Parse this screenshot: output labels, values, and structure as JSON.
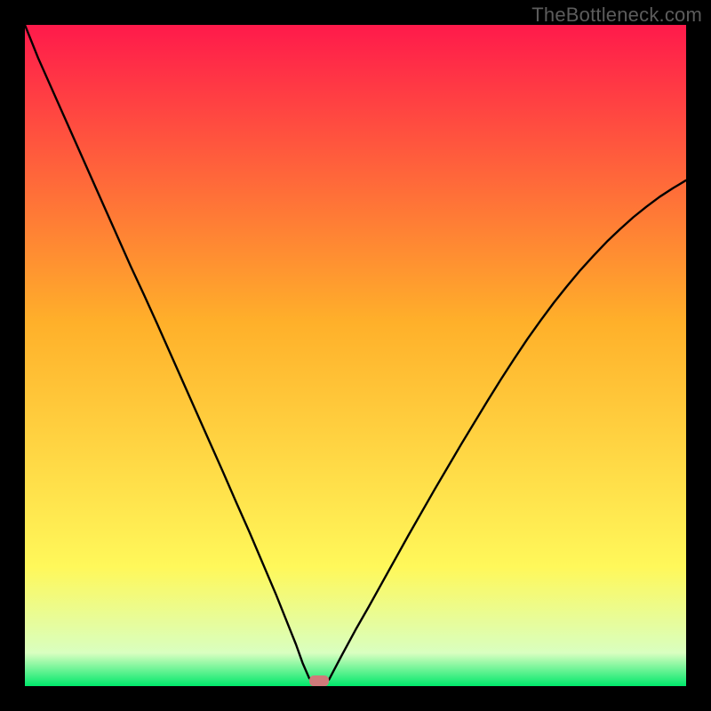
{
  "watermark_text": "TheBottleneck.com",
  "chart_data": {
    "type": "line",
    "title": "",
    "xlabel": "",
    "ylabel": "",
    "xlim": [
      0,
      100
    ],
    "ylim": [
      0,
      100
    ],
    "grid": false,
    "legend": false,
    "background_gradient": {
      "top": "#ff1a4b",
      "mid": "#ffb02a",
      "lower": "#fff85a",
      "band_pale_green": "#d9ffc0",
      "bottom": "#00e86b"
    },
    "marker": {
      "x": 44.5,
      "y": 0.8,
      "color": "#d07a7a",
      "shape": "rounded-pill"
    },
    "series": [
      {
        "name": "curve",
        "color": "#000000",
        "x": [
          0,
          2,
          4,
          6,
          8,
          10,
          12,
          14,
          16,
          18,
          20,
          22,
          24,
          26,
          28,
          30,
          32,
          34,
          36,
          38,
          40,
          41,
          42,
          43,
          44,
          45,
          46,
          48,
          50,
          52,
          54,
          56,
          58,
          60,
          62,
          64,
          66,
          68,
          70,
          72,
          74,
          76,
          78,
          80,
          82,
          84,
          86,
          88,
          90,
          92,
          94,
          96,
          98,
          100
        ],
        "y": [
          100,
          95,
          90.5,
          86,
          81.5,
          77,
          72.5,
          68,
          63.5,
          59.2,
          54.8,
          50.3,
          45.8,
          41.3,
          36.8,
          32.3,
          27.7,
          23.2,
          18.5,
          13.8,
          8.8,
          6.3,
          3.5,
          1.2,
          0.4,
          0.5,
          1.0,
          4.8,
          8.5,
          12.0,
          15.6,
          19.2,
          22.8,
          26.3,
          29.8,
          33.2,
          36.6,
          39.9,
          43.2,
          46.4,
          49.5,
          52.5,
          55.3,
          58.0,
          60.5,
          62.9,
          65.1,
          67.2,
          69.1,
          70.9,
          72.5,
          74.0,
          75.3,
          76.5
        ]
      }
    ]
  }
}
